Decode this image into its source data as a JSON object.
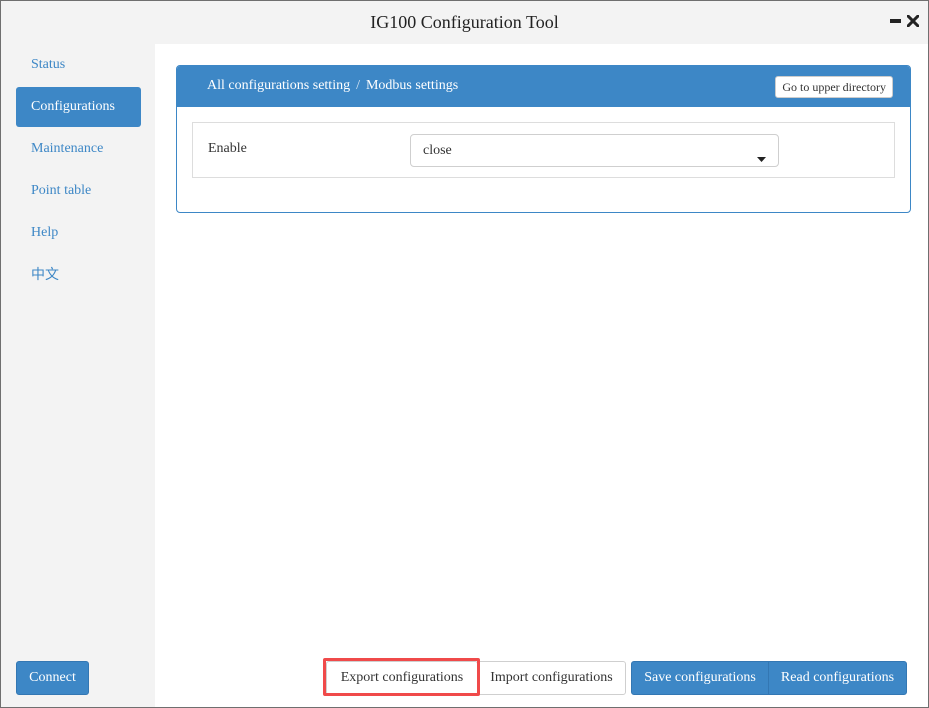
{
  "window": {
    "title": "IG100 Configuration Tool",
    "controls": {
      "minimize": "minimize-icon",
      "close": "close-icon"
    }
  },
  "sidebar": {
    "items": [
      {
        "label": "Status",
        "active": false
      },
      {
        "label": "Configurations",
        "active": true
      },
      {
        "label": "Maintenance",
        "active": false
      },
      {
        "label": "Point table",
        "active": false
      },
      {
        "label": "Help",
        "active": false
      },
      {
        "label": "中文",
        "active": false
      }
    ],
    "connect_label": "Connect"
  },
  "panel": {
    "breadcrumb": [
      "All configurations setting",
      "Modbus settings"
    ],
    "breadcrumb_separator": "/",
    "upper_directory_label": "Go to upper directory",
    "fields": [
      {
        "label": "Enable",
        "value": "close"
      }
    ]
  },
  "footer": {
    "export_label": "Export configurations",
    "import_label": "Import configurations",
    "save_label": "Save configurations",
    "read_label": "Read configurations"
  },
  "colors": {
    "accent": "#3d87c6",
    "highlight": "#f04a4a",
    "sidebar_bg": "#f3f3f3"
  }
}
